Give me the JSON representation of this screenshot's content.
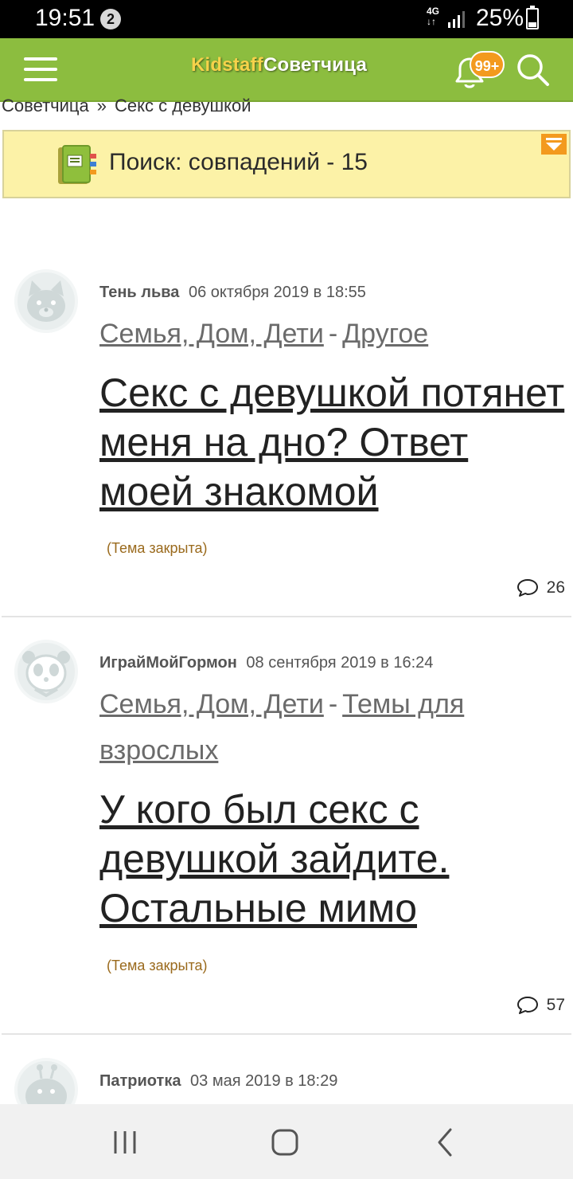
{
  "status_bar": {
    "time": "19:51",
    "notification_count": "2",
    "network": "4G",
    "battery": "25%"
  },
  "app_bar": {
    "logo_kidstaff": "Kidstaff",
    "logo_sovetchica": "Советчица",
    "notifications_badge": "99+"
  },
  "breadcrumb": {
    "items": [
      "Советчица",
      "Секс с девушкой"
    ],
    "separator": "»"
  },
  "search_banner": {
    "text": "Поиск: совпадений - 15"
  },
  "posts": [
    {
      "author": "Тень льва",
      "date": "06 октября 2019 в 18:55",
      "category": "Семья, Дом, Дети",
      "subcategory": "Другое",
      "title": "Секс с девушкой потянет меня на дно? Ответ моей знакомой",
      "status": "(Тема закрыта)",
      "comments": "26",
      "avatar_icon": "fox-avatar-icon"
    },
    {
      "author": "ИграйМойГормон",
      "date": "08 сентября 2019 в 16:24",
      "category": "Семья, Дом, Дети",
      "subcategory": "Темы для взрослых",
      "title": "У кого был секс с девушкой зайдите. Остальные мимо",
      "status": "(Тема закрыта)",
      "comments": "57",
      "avatar_icon": "panda-avatar-icon"
    },
    {
      "author": "Патриотка",
      "date": "03 мая 2019 в 18:29",
      "avatar_icon": "snail-avatar-icon"
    }
  ],
  "colors": {
    "app_bar": "#8cbd3f",
    "badge": "#f39a1e",
    "banner": "#fcf2a7",
    "closed_status": "#9a6a1d"
  }
}
